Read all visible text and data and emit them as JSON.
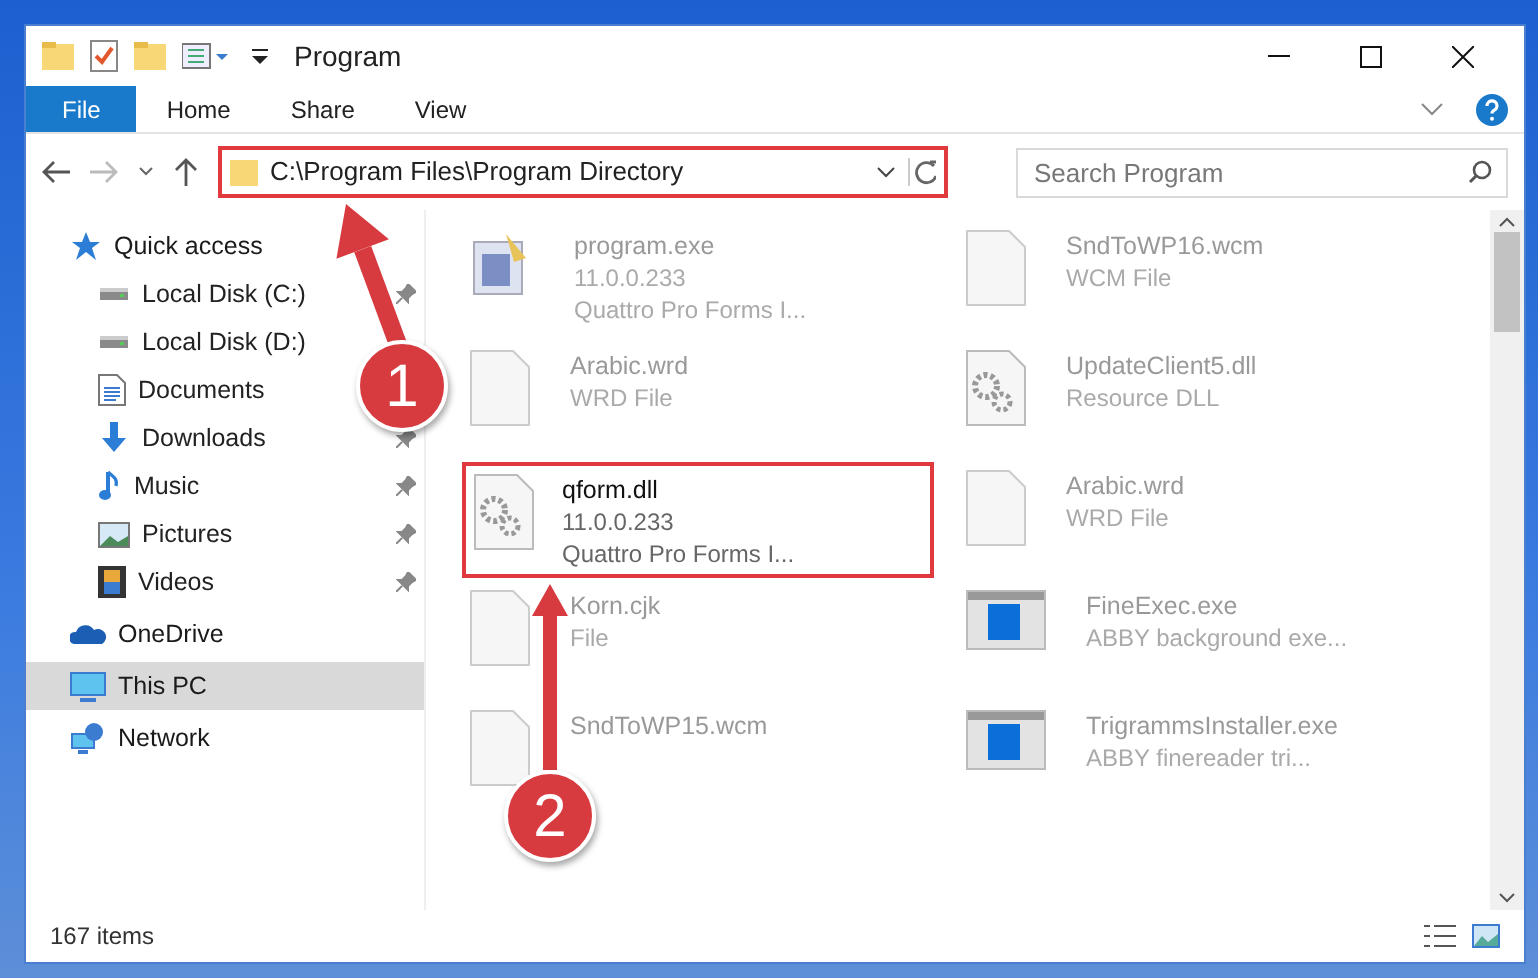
{
  "window": {
    "title": "Program"
  },
  "ribbon_tabs": [
    {
      "label": "File",
      "selected": true
    },
    {
      "label": "Home",
      "selected": false
    },
    {
      "label": "Share",
      "selected": false
    },
    {
      "label": "View",
      "selected": false
    }
  ],
  "address_bar": {
    "path": "C:\\Program Files\\Program Directory",
    "highlighted": true
  },
  "search": {
    "placeholder": "Search Program"
  },
  "sidebar": {
    "items": [
      {
        "label": "Quick access",
        "pinned": false,
        "selected": false,
        "children": [
          {
            "label": "Local Disk (C:)",
            "pinned": true,
            "selected": false
          },
          {
            "label": "Local Disk (D:)",
            "pinned": false,
            "selected": false
          },
          {
            "label": "Documents",
            "pinned": false,
            "selected": false
          },
          {
            "label": "Downloads",
            "pinned": true,
            "selected": false
          },
          {
            "label": "Music",
            "pinned": true,
            "selected": false
          },
          {
            "label": "Pictures",
            "pinned": true,
            "selected": false
          },
          {
            "label": "Videos",
            "pinned": true,
            "selected": false
          }
        ]
      },
      {
        "label": "OneDrive",
        "pinned": false,
        "selected": false
      },
      {
        "label": "This PC",
        "pinned": false,
        "selected": true
      },
      {
        "label": "Network",
        "pinned": false,
        "selected": false
      }
    ]
  },
  "files": [
    {
      "name": "program.exe",
      "lines": [
        "11.0.0.233",
        "Quattro Pro Forms I..."
      ],
      "kind": "exe",
      "highlighted": false
    },
    {
      "name": "SndToWP16.wcm",
      "lines": [
        "WCM File"
      ],
      "kind": "blank",
      "highlighted": false
    },
    {
      "name": "Arabic.wrd",
      "lines": [
        "WRD File"
      ],
      "kind": "blank",
      "highlighted": false
    },
    {
      "name": "UpdateClient5.dll",
      "lines": [
        "Resource DLL"
      ],
      "kind": "gears",
      "highlighted": false
    },
    {
      "name": "qform.dll",
      "lines": [
        "11.0.0.233",
        "Quattro Pro Forms I..."
      ],
      "kind": "gears",
      "highlighted": true
    },
    {
      "name": "Arabic.wrd",
      "lines": [
        "WRD File"
      ],
      "kind": "blank",
      "highlighted": false
    },
    {
      "name": "Korn.cjk",
      "lines": [
        "File"
      ],
      "kind": "blank",
      "highlighted": false
    },
    {
      "name": "FineExec.exe",
      "lines": [
        "ABBY background exe..."
      ],
      "kind": "app",
      "highlighted": false
    },
    {
      "name": "SndToWP15.wcm",
      "kind": "blank",
      "highlighted": false
    },
    {
      "name": "TrigrammsInstaller.exe",
      "lines": [
        "ABBY finereader tri..."
      ],
      "kind": "app",
      "highlighted": false
    }
  ],
  "status_bar": {
    "count": "167 items"
  },
  "annotations": [
    {
      "label": "1"
    },
    {
      "label": "2"
    }
  ]
}
